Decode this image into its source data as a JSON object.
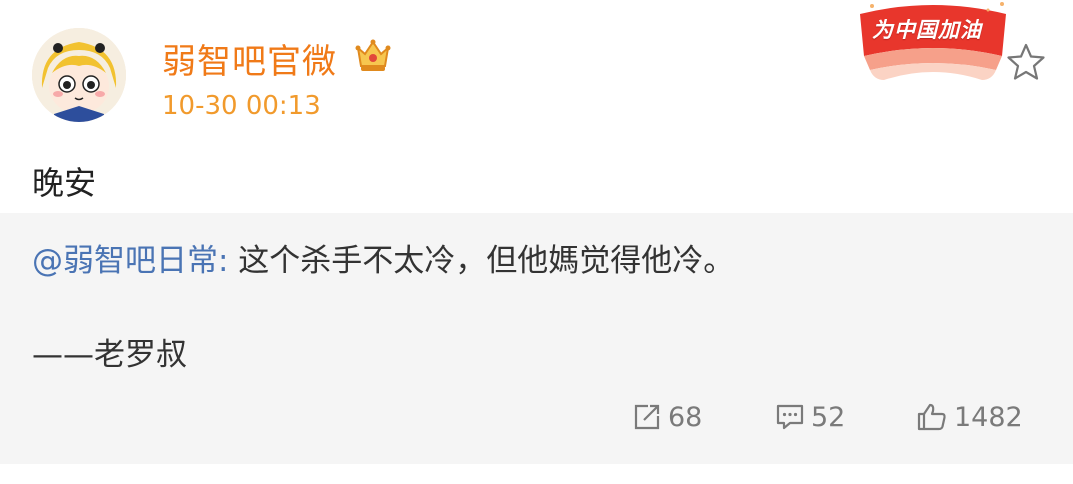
{
  "post": {
    "username": "弱智吧官微",
    "timestamp": "10-30 00:13",
    "badge_text": "为中国加油",
    "text": "晚安"
  },
  "repost": {
    "mention": "@弱智吧日常",
    "separator": ":",
    "text": " 这个杀手不太冷，但他媽觉得他冷。",
    "signature": "——老罗叔"
  },
  "actions": {
    "reposts": "68",
    "comments": "52",
    "likes": "1482"
  },
  "colors": {
    "username": "#f07a18",
    "timestamp": "#f19a2c",
    "mention": "#4a74b4",
    "repost_bg": "#f5f5f5",
    "action": "#7a7a7a"
  },
  "icons": {
    "avatar": "avatar-anime-girl",
    "vip": "crown-icon",
    "favorite": "star-icon",
    "repost": "repost-icon",
    "comment": "comment-icon",
    "like": "thumbs-up-icon"
  }
}
